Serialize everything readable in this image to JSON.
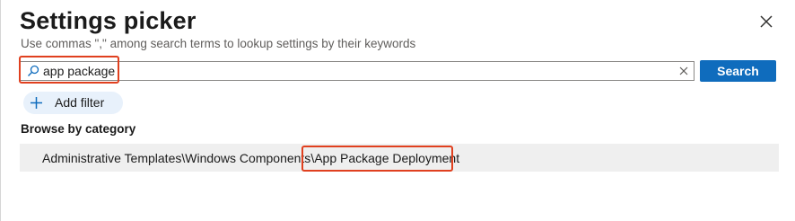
{
  "header": {
    "title": "Settings picker",
    "subtitle": "Use commas \",\" among search terms to lookup settings by their keywords"
  },
  "search": {
    "value": "app package",
    "button_label": "Search"
  },
  "filter": {
    "add_label": "Add filter"
  },
  "browse": {
    "heading": "Browse by category",
    "items": [
      {
        "path_prefix": "Administrative Templates\\Windows Components",
        "path_leaf": "\\App Package Deployment"
      }
    ]
  },
  "colors": {
    "accent": "#0f6cbd",
    "highlight": "#e0401f",
    "row_bg": "#efefef"
  },
  "icons": [
    "search-icon",
    "close-icon",
    "clear-icon",
    "plus-icon"
  ]
}
